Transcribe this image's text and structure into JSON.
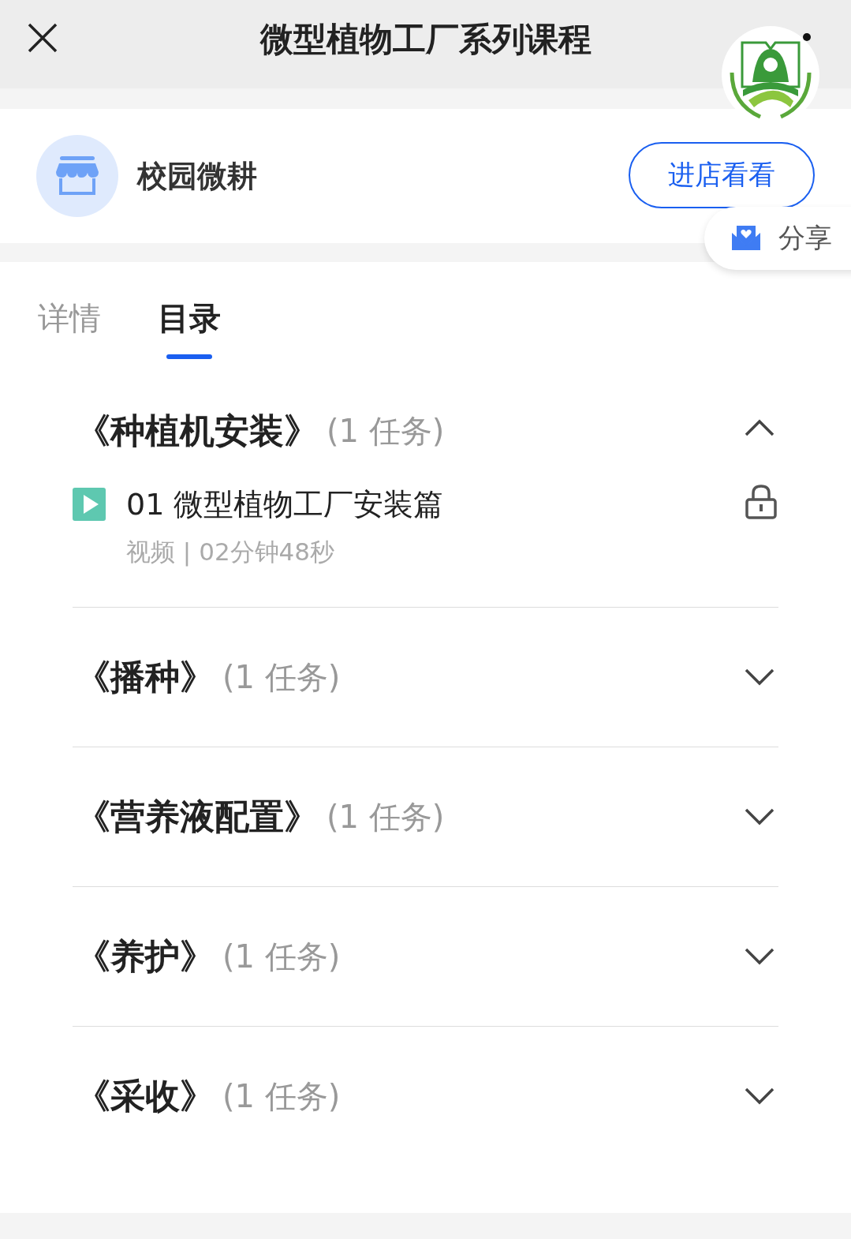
{
  "header": {
    "title": "微型植物工厂系列课程"
  },
  "shop": {
    "name": "校园微耕",
    "button": "进店看看"
  },
  "share": {
    "label": "分享"
  },
  "tabs": [
    {
      "label": "详情",
      "selected": false
    },
    {
      "label": "目录",
      "selected": true
    }
  ],
  "sections": [
    {
      "title": "《种植机安装》",
      "count": "(1 任务)",
      "expanded": true,
      "items": [
        {
          "title": "01 微型植物工厂安装篇",
          "meta": "视频 | 02分钟48秒",
          "locked": true
        }
      ]
    },
    {
      "title": "《播种》",
      "count": "(1 任务)",
      "expanded": false
    },
    {
      "title": "《营养液配置》",
      "count": "(1 任务)",
      "expanded": false
    },
    {
      "title": "《养护》",
      "count": "(1 任务)",
      "expanded": false
    },
    {
      "title": "《采收》",
      "count": "(1 任务)",
      "expanded": false
    }
  ]
}
